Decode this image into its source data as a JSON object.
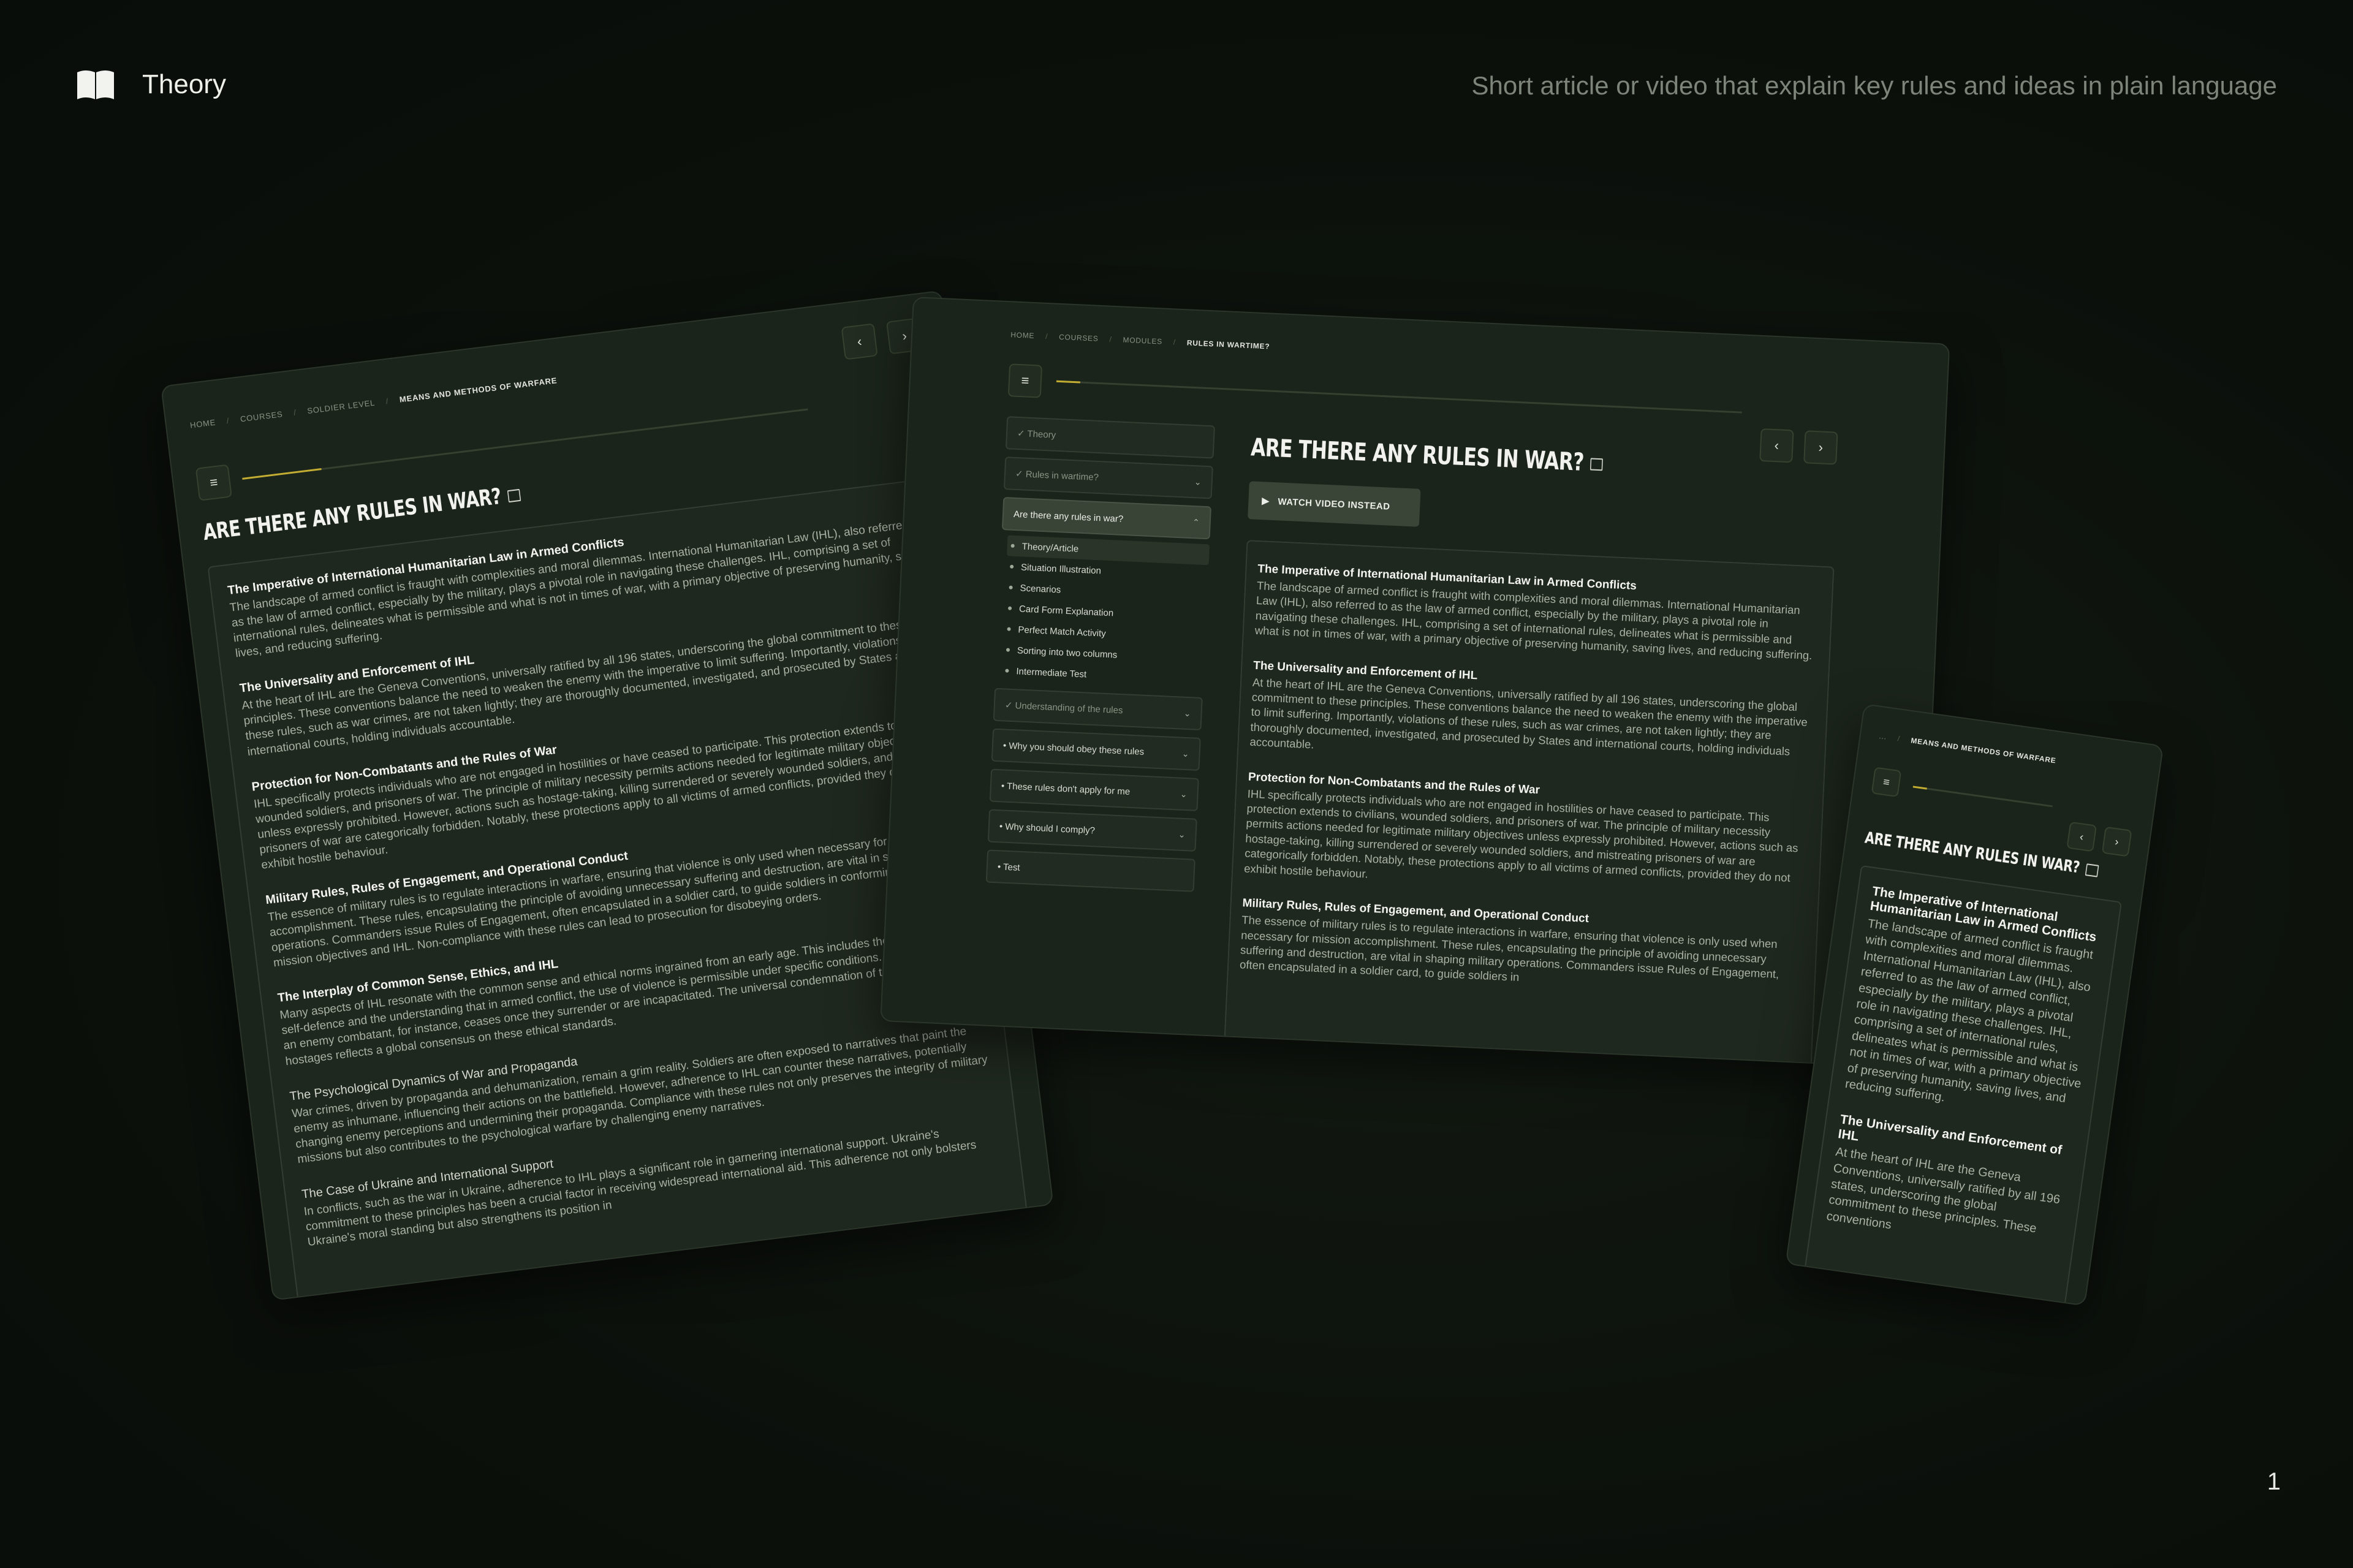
{
  "header": {
    "title": "Theory",
    "tagline": "Short article or video that explain key rules and ideas in plain language",
    "page_number": "1"
  },
  "tablet": {
    "breadcrumb": [
      "HOME",
      "COURSES",
      "SOLDIER LEVEL",
      "MEANS AND METHODS OF WARFARE"
    ],
    "title": "ARE THERE ANY RULES IN WAR?",
    "sections": [
      {
        "heading": "The Imperative of International Humanitarian Law in Armed Conflicts",
        "body": "The landscape of armed conflict is fraught with complexities and moral dilemmas. International Humanitarian Law (IHL), also referred to as the law of armed conflict, especially by the military, plays a pivotal role in navigating these challenges. IHL, comprising a set of international rules, delineates what is permissible and what is not in times of war, with a primary objective of preserving humanity, saving lives, and reducing suffering."
      },
      {
        "heading": "The Universality and Enforcement of IHL",
        "body": "At the heart of IHL are the Geneva Conventions, universally ratified by all 196 states, underscoring the global commitment to these principles. These conventions balance the need to weaken the enemy with the imperative to limit suffering. Importantly, violations of these rules, such as war crimes, are not taken lightly; they are thoroughly documented, investigated, and prosecuted by States and international courts, holding individuals accountable."
      },
      {
        "heading": "Protection for Non-Combatants and the Rules of War",
        "body": "IHL specifically protects individuals who are not engaged in hostilities or have ceased to participate. This protection extends to civilians, wounded soldiers, and prisoners of war. The principle of military necessity permits actions needed for legitimate military objectives unless expressly prohibited. However, actions such as hostage-taking, killing surrendered or severely wounded soldiers, and mistreating prisoners of war are categorically forbidden. Notably, these protections apply to all victims of armed conflicts, provided they do not exhibit hostile behaviour."
      },
      {
        "heading": "Military Rules, Rules of Engagement, and Operational Conduct",
        "body": "The essence of military rules is to regulate interactions in warfare, ensuring that violence is only used when necessary for mission accomplishment. These rules, encapsulating the principle of avoiding unnecessary suffering and destruction, are vital in shaping military operations. Commanders issue Rules of Engagement, often encapsulated in a soldier card, to guide soldiers in conforming to both the mission objectives and IHL. Non-compliance with these rules can lead to prosecution for disobeying orders."
      },
      {
        "heading": "The Interplay of Common Sense, Ethics, and IHL",
        "body": "Many aspects of IHL resonate with the common sense and ethical norms ingrained from an early age. This includes the inherent right to self-defence and the understanding that in armed conflict, the use of violence is permissible under specific conditions. The right to attack an enemy combatant, for instance, ceases once they surrender or are incapacitated. The universal condemnation of torture and taking hostages reflects a global consensus on these ethical standards."
      },
      {
        "heading": "The Psychological Dynamics of War and Propaganda",
        "body": "War crimes, driven by propaganda and dehumanization, remain a grim reality. Soldiers are often exposed to narratives that paint the enemy as inhumane, influencing their actions on the battlefield. However, adherence to IHL can counter these narratives, potentially changing enemy perceptions and undermining their propaganda. Compliance with these rules not only preserves the integrity of military missions but also contributes to the psychological warfare by challenging enemy narratives."
      },
      {
        "heading": "The Case of Ukraine and International Support",
        "body": "In conflicts, such as the war in Ukraine, adherence to IHL plays a significant role in garnering international support. Ukraine's commitment to these principles has been a crucial factor in receiving widespread international aid. This adherence not only bolsters Ukraine's moral standing but also strengthens its position in"
      }
    ]
  },
  "desktop": {
    "breadcrumb": [
      "HOME",
      "COURSES",
      "MODULES",
      "RULES IN WARTIME?"
    ],
    "title": "ARE THERE ANY RULES IN WAR?",
    "watch_label": "WATCH VIDEO INSTEAD",
    "sidebar": {
      "theory": "Theory",
      "rules_in_wartime": "Rules in wartime?",
      "active_group": "Are there any rules in war?",
      "subitems": [
        "Theory/Article",
        "Situation Illustration",
        "Scenarios",
        "Card Form Explanation",
        "Perfect Match Activity",
        "Sorting into two columns",
        "Intermediate Test"
      ],
      "groups": [
        "Understanding of the rules",
        "Why you should obey these rules",
        "These rules don't apply for me",
        "Why should I comply?",
        "Test"
      ]
    },
    "sections": [
      {
        "heading": "The Imperative of International Humanitarian Law in Armed Conflicts",
        "body": "The landscape of armed conflict is fraught with complexities and moral dilemmas. International Humanitarian Law (IHL), also referred to as the law of armed conflict, especially by the military, plays a pivotal role in navigating these challenges. IHL, comprising a set of international rules, delineates what is permissible and what is not in times of war, with a primary objective of preserving humanity, saving lives, and reducing suffering."
      },
      {
        "heading": "The Universality and Enforcement of IHL",
        "body": "At the heart of IHL are the Geneva Conventions, universally ratified by all 196 states, underscoring the global commitment to these principles. These conventions balance the need to weaken the enemy with the imperative to limit suffering. Importantly, violations of these rules, such as war crimes, are not taken lightly; they are thoroughly documented, investigated, and prosecuted by States and international courts, holding individuals accountable."
      },
      {
        "heading": "Protection for Non-Combatants and the Rules of War",
        "body": "IHL specifically protects individuals who are not engaged in hostilities or have ceased to participate. This protection extends to civilians, wounded soldiers, and prisoners of war. The principle of military necessity permits actions needed for legitimate military objectives unless expressly prohibited. However, actions such as hostage-taking, killing surrendered or severely wounded soldiers, and mistreating prisoners of war are categorically forbidden. Notably, these protections apply to all victims of armed conflicts, provided they do not exhibit hostile behaviour."
      },
      {
        "heading": "Military Rules, Rules of Engagement, and Operational Conduct",
        "body": "The essence of military rules is to regulate interactions in warfare, ensuring that violence is only used when necessary for mission accomplishment. These rules, encapsulating the principle of avoiding unnecessary suffering and destruction, are vital in shaping military operations. Commanders issue Rules of Engagement, often encapsulated in a soldier card, to guide soldiers in"
      }
    ]
  },
  "phone": {
    "breadcrumb": [
      "...",
      "MEANS AND METHODS OF WARFARE"
    ],
    "title": "ARE THERE ANY RULES IN WAR?",
    "sections": [
      {
        "heading": "The Imperative of International Humanitarian Law in Armed Conflicts",
        "body": "The landscape of armed conflict is fraught with complexities and moral dilemmas. International Humanitarian Law (IHL), also referred to as the law of armed conflict, especially by the military, plays a pivotal role in navigating these challenges. IHL, comprising a set of international rules, delineates what is permissible and what is not in times of war, with a primary objective of preserving humanity, saving lives, and reducing suffering."
      },
      {
        "heading": "The Universality and Enforcement of IHL",
        "body": "At the heart of IHL are the Geneva Conventions, universally ratified by all 196 states, underscoring the global commitment to these principles. These conventions"
      }
    ]
  }
}
